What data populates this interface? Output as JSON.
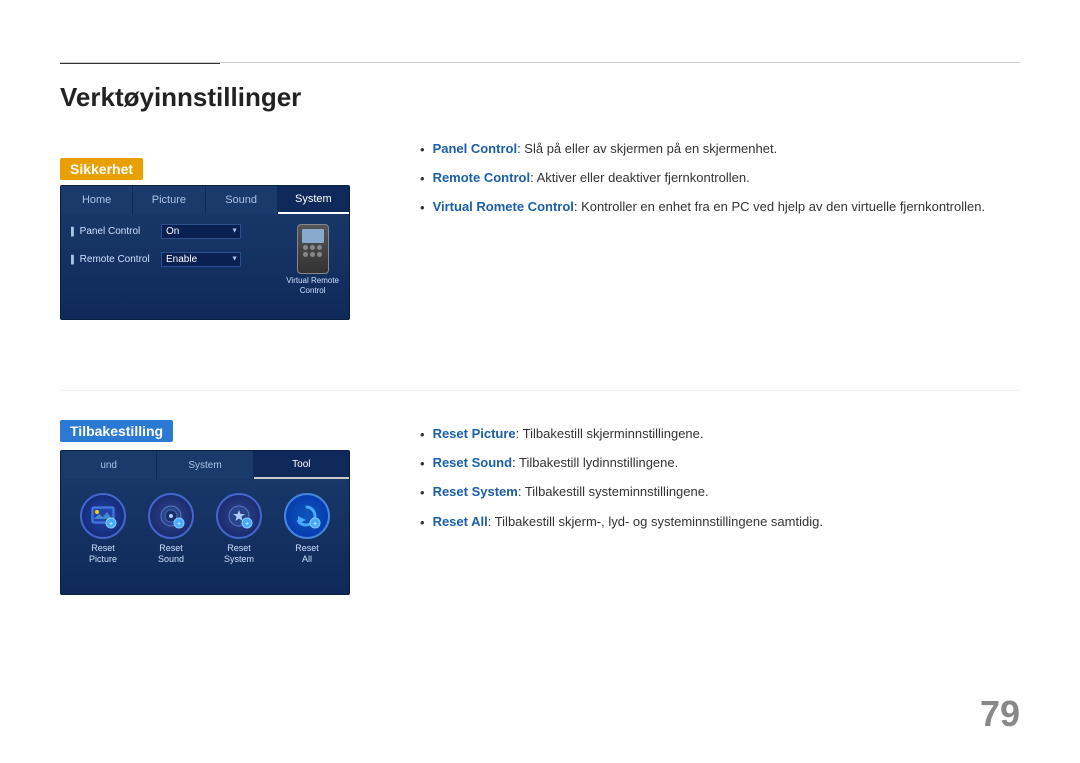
{
  "page": {
    "number": "79"
  },
  "header": {
    "title": "Verktøyinnstillinger"
  },
  "sikkerhet": {
    "badge": "Sikkerhet",
    "menu": {
      "tabs": [
        "Home",
        "Picture",
        "Sound",
        "System"
      ],
      "active_tab": "System",
      "rows": [
        {
          "label": "Panel Control",
          "value": "On"
        },
        {
          "label": "Remote Control",
          "value": "Enable"
        }
      ],
      "virtual_remote_label": "Virtual Remote\nControl"
    },
    "bullets": [
      {
        "term": "Panel Control",
        "text": ": Slå på eller av skjermen på en skjermenhet."
      },
      {
        "term": "Remote Control",
        "text": ": Aktiver eller deaktiver fjernkontrollen."
      },
      {
        "term": "Virtual Romete Control",
        "text": ": Kontroller en enhet fra en PC ved hjelp av den virtuelle fjernkontrollen."
      }
    ]
  },
  "tilbakestilling": {
    "badge": "Tilbakestilling",
    "menu": {
      "tabs": [
        "und",
        "System",
        "Tool"
      ],
      "active_tab": "Tool",
      "items": [
        {
          "label": "Reset\nPicture"
        },
        {
          "label": "Reset\nSound"
        },
        {
          "label": "Reset\nSystem"
        },
        {
          "label": "Reset\nAll"
        }
      ]
    },
    "bullets": [
      {
        "term": "Reset Picture",
        "text": ": Tilbakestill skjerminnstillingene."
      },
      {
        "term": "Reset Sound",
        "text": ": Tilbakestill lydinnstillingene."
      },
      {
        "term": "Reset System",
        "text": ": Tilbakestill systeminnstillingene."
      },
      {
        "term": "Reset All",
        "text": ": Tilbakestill skjerm-, lyd- og systeminnstillingene samtidig."
      }
    ]
  }
}
